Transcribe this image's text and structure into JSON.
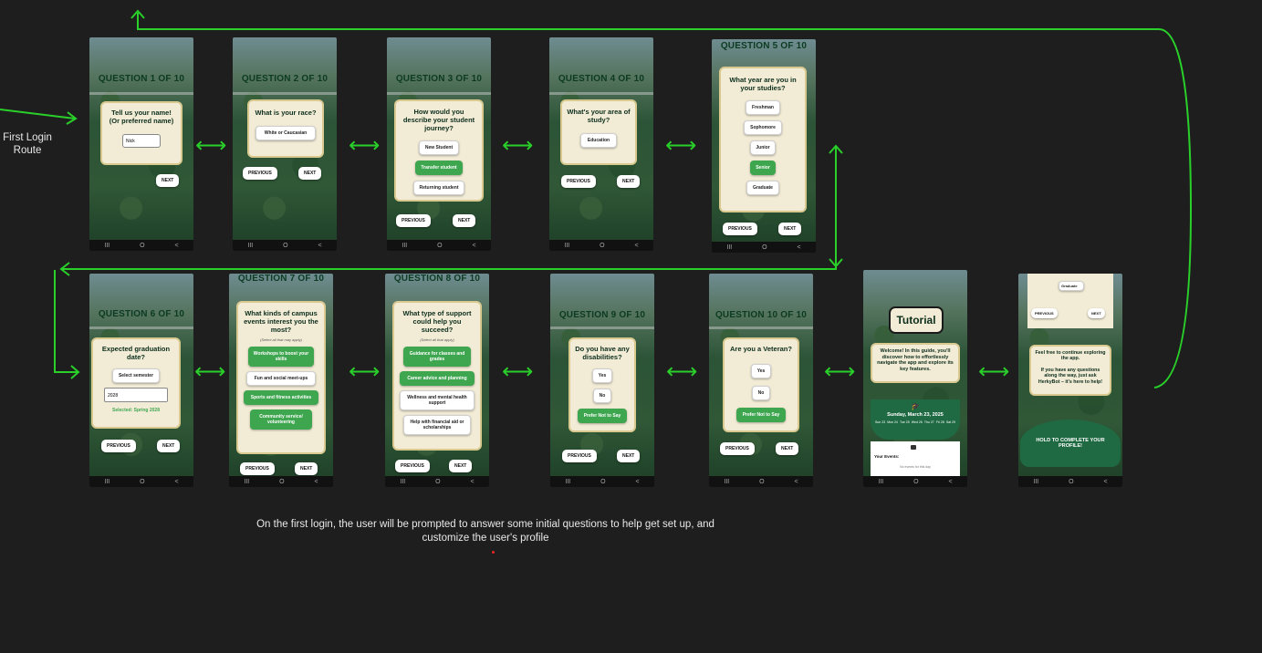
{
  "route_label": "First Login Route",
  "caption": "On the first login, the user will be prompted to answer some initial questions to help get set up, and customize the user's profile",
  "accent_color": "#2ad02a",
  "nav_icons": [
    "III",
    "O",
    "<"
  ],
  "arrow_glyph": "⟷",
  "screens": {
    "q1": {
      "title": "QUESTION 1 OF 10",
      "question": "Tell us your name! (Or preferred name)",
      "input_value": "Nick",
      "next": "NEXT"
    },
    "q2": {
      "title": "QUESTION 2 OF 10",
      "question": "What is your race?",
      "selected": "White or Caucasian",
      "prev": "PREVIOUS",
      "next": "NEXT"
    },
    "q3": {
      "title": "QUESTION 3 OF 10",
      "question": "How would you describe your student journey?",
      "options": [
        "New Student",
        "Transfer student",
        "Returning student"
      ],
      "prev": "PREVIOUS",
      "next": "NEXT"
    },
    "q4": {
      "title": "QUESTION 4 OF 10",
      "question": "What's your area of study?",
      "selected": "Education",
      "prev": "PREVIOUS",
      "next": "NEXT"
    },
    "q5": {
      "title": "QUESTION 5 OF 10",
      "question": "What year are you in your studies?",
      "options": [
        "Freshman",
        "Sophomore",
        "Junior",
        "Senior",
        "Graduate"
      ],
      "prev": "PREVIOUS",
      "next": "NEXT"
    },
    "q6": {
      "title": "QUESTION 6 OF 10",
      "question": "Expected graduation date?",
      "select_label": "Select semester",
      "input_value": "2028",
      "selected_text": "Selected: Spring 2028",
      "prev": "PREVIOUS",
      "next": "NEXT"
    },
    "q7": {
      "title": "QUESTION 7 OF 10",
      "question": "What kinds of campus events interest you the most?",
      "hint": "(Select all that may apply)",
      "options": [
        "Workshops to boost your skills",
        "Fun and social meet-ups",
        "Sports and fitness activities",
        "Community service/ volunteering"
      ],
      "prev": "PREVIOUS",
      "next": "NEXT"
    },
    "q8": {
      "title": "QUESTION 8 OF 10",
      "question": "What type of support could help you succeed?",
      "hint": "(Select all that apply)",
      "options": [
        "Guidance for classes and grades",
        "Career advice and planning",
        "Wellness and mental health support",
        "Help with financial aid or scholarships"
      ],
      "prev": "PREVIOUS",
      "next": "NEXT"
    },
    "q9": {
      "title": "QUESTION 9 OF 10",
      "question": "Do you have any disabilities?",
      "options": [
        "Yes",
        "No",
        "Prefer Not to Say"
      ],
      "prev": "PREVIOUS",
      "next": "NEXT"
    },
    "q10": {
      "title": "QUESTION 10 OF 10",
      "question": "Are you a Veteran?",
      "options": [
        "Yes",
        "No",
        "Prefer Not to Say"
      ],
      "prev": "PREVIOUS",
      "next": "NEXT"
    },
    "tutorial": {
      "title": "Tutorial",
      "body": "Welcome! In this guide, you'll discover how to effortlessly navigate the app and explore its key features.",
      "date": "Sunday, March 23, 2025",
      "days": [
        "Sun 23",
        "Mon 24",
        "Tue 25",
        "Wed 26",
        "Thu 27",
        "Fri 28",
        "Sat 29"
      ],
      "events_label": "Your Events:",
      "no_events": "No events for this day"
    },
    "final": {
      "graduate": "Graduate",
      "prev": "PREVIOUS",
      "next": "NEXT",
      "message": "Feel free to continue exploring the app.\n\nIf you have any questions along the way, just ask HerkyBot – it's here to help!",
      "hold": "HOLD TO COMPLETE YOUR PROFILE!"
    }
  }
}
